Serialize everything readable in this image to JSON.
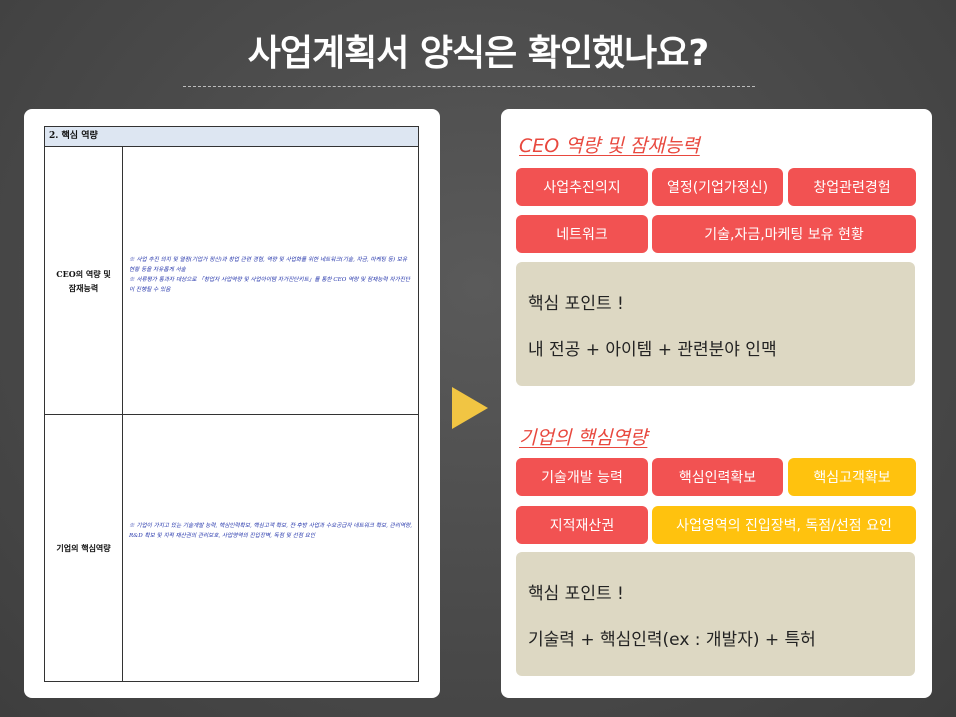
{
  "title": "사업계획서 양식은 확인했나요?",
  "form": {
    "header": "2. 핵심 역량",
    "rows": [
      {
        "label_line1": "CEO의 역량 및",
        "label_line2": "잠재능력",
        "notes": [
          "※ 사업 추진 의지 및 열정(기업가 정신)과 창업 관련 경험, 역량 및 사업화를 위한 네트워크(기술, 자금, 마케팅 등) 보유 현황 등을 자유롭게 서술",
          "※ 서류평가 통과자 대상으로 「창업자 사업역량 및 사업아이템 자가진단키트」를 통한 CEO 역량 및 잠재능력 자가진단이 진행될 수 있음"
        ]
      },
      {
        "label_line1": "기업의 핵심역량",
        "label_line2": "",
        "notes": [
          "※ 기업이 가지고 있는 기술개발 능력, 핵심인력확보, 핵심고객 확보, 전·후방 사업과 수요공급자 네트워크 확보, 관리역량, R&D 확보 및 지적 재산권의 관리보호, 사업영역의 진입장벽, 독점 및 선점 요인"
        ]
      }
    ]
  },
  "colors": {
    "chip_red": "#f25252",
    "chip_yellow": "#ffc20e",
    "accent_title": "#e8483e",
    "point_box": "#ddd8c3",
    "arrow": "#f1c543"
  },
  "section1": {
    "title": "CEO 역량 및 잠재능력",
    "chips": [
      "사업추진의지",
      "열정(기업가정신)",
      "창업관련경험",
      "네트워크",
      "기술,자금,마케팅 보유 현황"
    ],
    "point_title": "핵심 포인트 !",
    "point_text": "내 전공 + 아이템 + 관련분야 인맥"
  },
  "section2": {
    "title": "기업의 핵심역량",
    "chips": [
      "기술개발 능력",
      "핵심인력확보",
      "핵심고객확보",
      "지적재산권",
      "사업영역의 진입장벽, 독점/선점 요인"
    ],
    "point_title": "핵심 포인트 !",
    "point_text": "기술력 + 핵심인력(ex : 개발자) + 특허"
  }
}
